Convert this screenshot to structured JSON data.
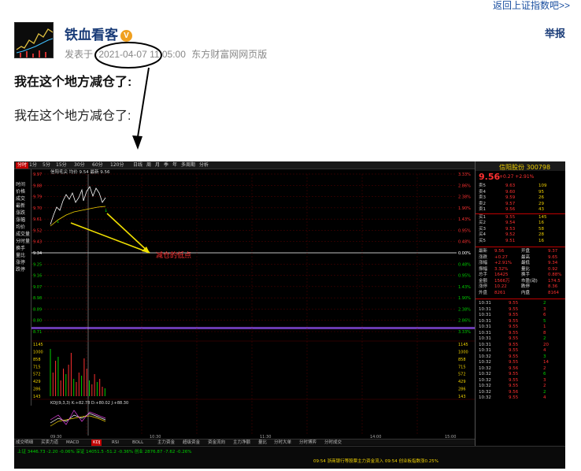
{
  "nav": {
    "back_link": "返回上证指数吧>>",
    "report": "举报"
  },
  "post": {
    "author": "铁血看客",
    "badge": "V",
    "posted_label": "发表于",
    "posted_time": "2021-04-07 11:05:00",
    "source": "东方财富网网页版",
    "title": "我在这个地方减仓了:",
    "body": "我在这个地方减仓了:"
  },
  "screenshot": {
    "annotation": "减仓的低点",
    "top_tabs": [
      "分时",
      "1分",
      "5分",
      "15分",
      "30分",
      "60分",
      "120分",
      "日线",
      "周",
      "月",
      "季",
      "年",
      "多周期",
      "分析"
    ],
    "active_tab": "分时",
    "chart_header": "信阳毛尖 均价 9.54 最新 9.56",
    "left_items": [
      "时间",
      "价格",
      "成交",
      "最新",
      "涨跌",
      "涨幅",
      "均价",
      "成交量",
      "分时量",
      "换手",
      "量比",
      "涨停",
      "跌停"
    ],
    "price_labels_left": [
      "9.97",
      "9.88",
      "9.79",
      "9.70",
      "9.61",
      "9.52",
      "9.43",
      "9.34",
      "9.25",
      "9.16",
      "9.07",
      "8.98",
      "8.89",
      "8.80",
      "8.71"
    ],
    "pct_labels_right": [
      "3.33%",
      "2.86%",
      "2.38%",
      "1.90%",
      "1.43%",
      "0.95%",
      "0.48%",
      "0.00%",
      "0.48%",
      "0.95%",
      "1.43%",
      "1.90%",
      "2.38%",
      "2.86%",
      "3.33%"
    ],
    "volume_labels": [
      "1145",
      "1000",
      "858",
      "715",
      "572",
      "429",
      "286",
      "143"
    ],
    "indicator": "KDJ(9,3,3) K:+82.78 D:+80.02 J:+88.30",
    "time_labels": [
      "09:30",
      "10:30",
      "11:30",
      "14:00",
      "15:00"
    ],
    "stock_name": "信阳股份 300798",
    "last_price": "9.56",
    "last_change": "+0.27 +2.91%",
    "order_book": [
      {
        "label": "卖5",
        "price": "9.63",
        "vol": "109"
      },
      {
        "label": "卖4",
        "price": "9.60",
        "vol": "95"
      },
      {
        "label": "卖3",
        "price": "9.59",
        "vol": "26"
      },
      {
        "label": "卖2",
        "price": "9.57",
        "vol": "29"
      },
      {
        "label": "卖1",
        "price": "9.56",
        "vol": "43"
      },
      {
        "label": "买1",
        "price": "9.55",
        "vol": "145"
      },
      {
        "label": "买2",
        "price": "9.54",
        "vol": "16"
      },
      {
        "label": "买3",
        "price": "9.53",
        "vol": "58"
      },
      {
        "label": "买4",
        "price": "9.52",
        "vol": "28"
      },
      {
        "label": "买5",
        "price": "9.51",
        "vol": "16"
      }
    ],
    "quote_fields": [
      {
        "k": "最新",
        "v": "9.56",
        "k2": "开盘",
        "v2": "9.37"
      },
      {
        "k": "涨跌",
        "v": "+0.27",
        "k2": "最高",
        "v2": "9.65"
      },
      {
        "k": "涨幅",
        "v": "+2.91%",
        "k2": "最低",
        "v2": "9.34"
      },
      {
        "k": "振幅",
        "v": "3.32%",
        "k2": "量比",
        "v2": "0.92"
      },
      {
        "k": "总手",
        "v": "16425",
        "k2": "换手",
        "v2": "0.88%"
      },
      {
        "k": "金额",
        "v": "1566万",
        "k2": "市盈(动)",
        "v2": "174.5"
      },
      {
        "k": "涨停",
        "v": "10.22",
        "k2": "跌停",
        "v2": "8.36"
      },
      {
        "k": "外盘",
        "v": "8261",
        "k2": "内盘",
        "v2": "8164"
      }
    ],
    "ticks": [
      {
        "t": "10:31",
        "p": "9.55",
        "v": "2"
      },
      {
        "t": "10:31",
        "p": "9.55",
        "v": "3"
      },
      {
        "t": "10:31",
        "p": "9.55",
        "v": "6"
      },
      {
        "t": "10:31",
        "p": "9.55",
        "v": "5"
      },
      {
        "t": "10:31",
        "p": "9.55",
        "v": "1"
      },
      {
        "t": "10:31",
        "p": "9.55",
        "v": "8"
      },
      {
        "t": "10:31",
        "p": "9.55",
        "v": "2"
      },
      {
        "t": "10:31",
        "p": "9.55",
        "v": "20"
      },
      {
        "t": "10:31",
        "p": "9.55",
        "v": "4"
      },
      {
        "t": "10:32",
        "p": "9.55",
        "v": "3"
      },
      {
        "t": "10:32",
        "p": "9.55",
        "v": "14"
      },
      {
        "t": "10:32",
        "p": "9.56",
        "v": "2"
      },
      {
        "t": "10:32",
        "p": "9.55",
        "v": "6"
      },
      {
        "t": "10:32",
        "p": "9.55",
        "v": "3"
      },
      {
        "t": "10:32",
        "p": "9.55",
        "v": "2"
      },
      {
        "t": "10:32",
        "p": "9.56",
        "v": "2"
      },
      {
        "t": "10:32",
        "p": "9.55",
        "v": "4"
      }
    ],
    "bottom_tabs": [
      "成交明细",
      "买卖力道",
      "MACD",
      "KDJ",
      "RSI",
      "BOLL",
      "主力资金",
      "超级资金",
      "资金流向",
      "主力净额",
      "量比",
      "分时大单",
      "分时博弈",
      "分时成交"
    ],
    "active_bottom_tab": "KDJ",
    "status_line1": "上证 3446.73 -2.20 -0.06%  深证 14051.5 -51.2 -0.36%  创业 2876.87 -7.62 -0.26%",
    "status_line2": "09:54 浙商银行等股票主力资金流入  09:54 创业板指数涨0.25%"
  }
}
